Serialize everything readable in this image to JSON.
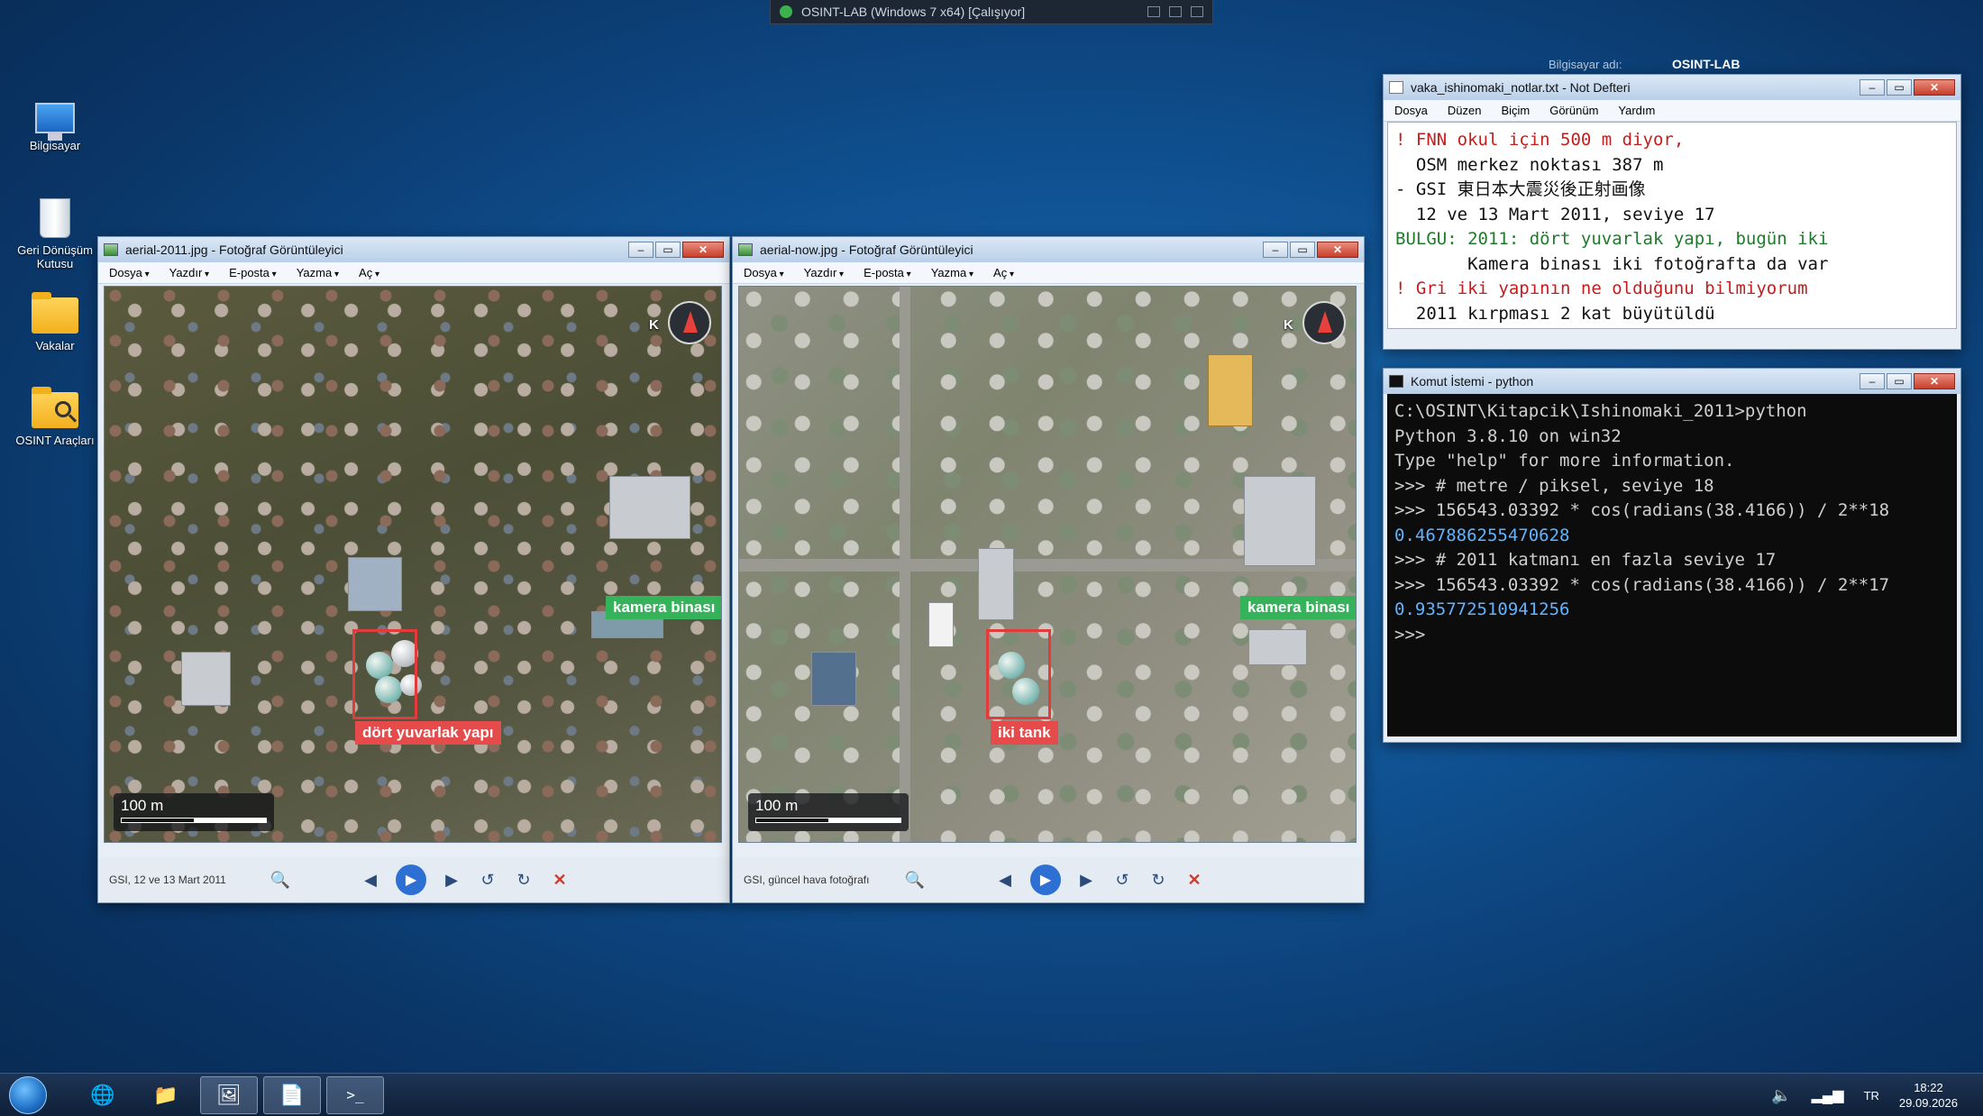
{
  "vm": {
    "title": "OSINT-LAB (Windows 7 x64) [Çalışıyor]"
  },
  "host": {
    "label": "Bilgisayar adı:",
    "value": "OSINT-LAB"
  },
  "desktop": {
    "icons": [
      {
        "label": "Bilgisayar"
      },
      {
        "label": "Geri Dönüşüm Kutusu"
      },
      {
        "label": "Vakalar"
      },
      {
        "label": "OSINT Araçları"
      }
    ]
  },
  "viewer_old": {
    "title": "aerial-2011.jpg - Fotoğraf Görüntüleyici",
    "menu": [
      "Dosya",
      "Yazdır",
      "E-posta",
      "Yazma",
      "Aç"
    ],
    "north": "K",
    "scale": "100 m",
    "tag_tanks": "dört yuvarlak yapı",
    "tag_camera": "kamera binası",
    "caption": "GSI, 12 ve 13 Mart 2011"
  },
  "viewer_now": {
    "title": "aerial-now.jpg - Fotoğraf Görüntüleyici",
    "menu": [
      "Dosya",
      "Yazdır",
      "E-posta",
      "Yazma",
      "Aç"
    ],
    "north": "K",
    "scale": "100 m",
    "tag_tanks": "iki tank",
    "tag_camera": "kamera binası",
    "caption": "GSI, güncel hava fotoğrafı"
  },
  "notepad": {
    "title": "vaka_ishinomaki_notlar.txt - Not Defteri",
    "menu": [
      "Dosya",
      "Düzen",
      "Biçim",
      "Görünüm",
      "Yardım"
    ],
    "lines": [
      "! FNN okul için 500 m diyor,",
      "  OSM merkez noktası 387 m",
      "- GSI 東日本大震災後正射画像",
      "  12 ve 13 Mart 2011, seviye 17",
      "BULGU: 2011: dört yuvarlak yapı, bugün iki",
      "       Kamera binası iki fotoğrafta da var",
      "! Gri iki yapının ne olduğunu bilmiyorum",
      "  2011 kırpması 2 kat büyütüldü"
    ]
  },
  "cmd": {
    "title": "Komut İstemi - python",
    "lines": [
      "C:\\OSINT\\Kitapcik\\Ishinomaki_2011>python",
      "Python 3.8.10 on win32",
      "Type \"help\" for more information.",
      ">>> # metre / piksel, seviye 18",
      ">>> 156543.03392 * cos(radians(38.4166)) / 2**18",
      "0.467886255470628",
      ">>> # 2011 katmanı en fazla seviye 17",
      ">>> 156543.03392 * cos(radians(38.4166)) / 2**17",
      "0.935772510941256",
      ">>>"
    ]
  },
  "taskbar": {
    "lang": "TR",
    "time": "18:22",
    "date": "29.09.2026"
  },
  "colors": {
    "accent": "#2d6fd3",
    "tag_red": "#e54b4b",
    "tag_green": "#35b25a"
  }
}
